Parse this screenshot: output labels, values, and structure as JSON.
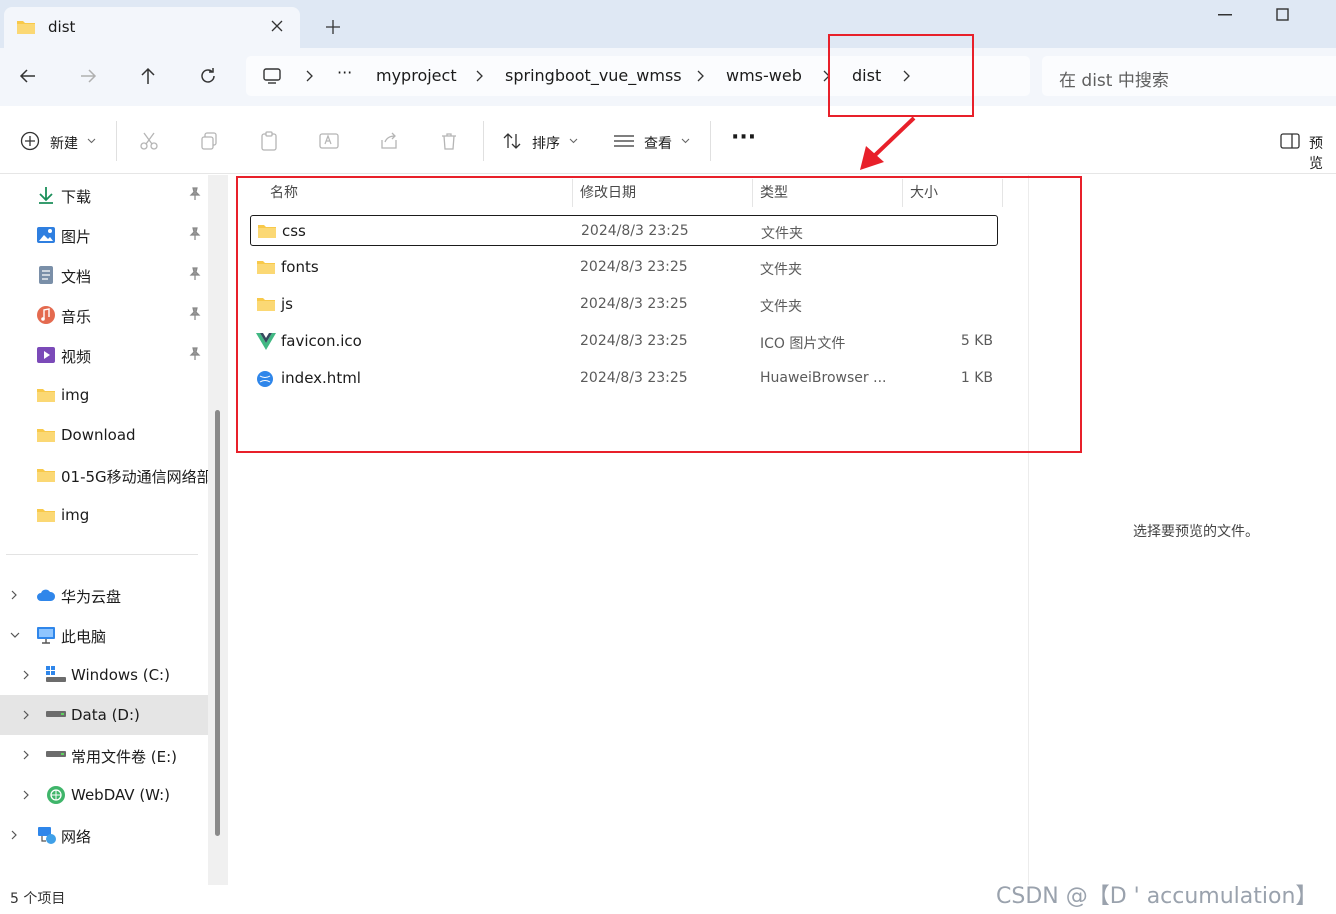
{
  "window": {
    "tab_title": "dist",
    "new_tab_symbol": "+"
  },
  "nav": {
    "breadcrumb": [
      "myproject",
      "springboot_vue_wmss",
      "wms-web",
      "dist"
    ],
    "ellipsis": "···",
    "search_placeholder": "在 dist 中搜索"
  },
  "toolbar": {
    "new_label": "新建",
    "sort_label": "排序",
    "view_label": "查看",
    "more_label": "···",
    "preview_label": "预览"
  },
  "sidebar": {
    "quick_access": [
      {
        "label": "下载",
        "icon": "download-icon",
        "pinned": true
      },
      {
        "label": "图片",
        "icon": "pictures-icon",
        "pinned": true
      },
      {
        "label": "文档",
        "icon": "documents-icon",
        "pinned": true
      },
      {
        "label": "音乐",
        "icon": "music-icon",
        "pinned": true
      },
      {
        "label": "视频",
        "icon": "videos-icon",
        "pinned": true
      },
      {
        "label": "img",
        "icon": "folder-icon",
        "pinned": false
      },
      {
        "label": "Download",
        "icon": "folder-icon",
        "pinned": false
      },
      {
        "label": "01-5G移动通信网络部",
        "icon": "folder-icon",
        "pinned": false
      },
      {
        "label": "img",
        "icon": "folder-icon",
        "pinned": false
      }
    ],
    "tree": [
      {
        "label": "华为云盘",
        "icon": "cloud-icon",
        "expanded": false
      },
      {
        "label": "此电脑",
        "icon": "this-pc-icon",
        "expanded": true
      },
      {
        "label": "Windows (C:)",
        "icon": "drive-c-icon",
        "expanded": false
      },
      {
        "label": "Data (D:)",
        "icon": "drive-icon",
        "expanded": false,
        "selected": true
      },
      {
        "label": "常用文件卷 (E:)",
        "icon": "drive-icon",
        "expanded": false
      },
      {
        "label": "WebDAV (W:)",
        "icon": "webdav-icon",
        "expanded": false
      },
      {
        "label": "网络",
        "icon": "network-icon",
        "expanded": false
      }
    ]
  },
  "file_list": {
    "columns": {
      "name": "名称",
      "date": "修改日期",
      "type": "类型",
      "size": "大小"
    },
    "rows": [
      {
        "name": "css",
        "date": "2024/8/3 23:25",
        "type": "文件夹",
        "size": "",
        "icon": "folder-icon"
      },
      {
        "name": "fonts",
        "date": "2024/8/3 23:25",
        "type": "文件夹",
        "size": "",
        "icon": "folder-icon"
      },
      {
        "name": "js",
        "date": "2024/8/3 23:25",
        "type": "文件夹",
        "size": "",
        "icon": "folder-icon"
      },
      {
        "name": "favicon.ico",
        "date": "2024/8/3 23:25",
        "type": "ICO 图片文件",
        "size": "5 KB",
        "icon": "vue-logo-icon"
      },
      {
        "name": "index.html",
        "date": "2024/8/3 23:25",
        "type": "HuaweiBrowser ...",
        "size": "1 KB",
        "icon": "browser-html-icon"
      }
    ]
  },
  "preview": {
    "message": "选择要预览的文件。"
  },
  "status": {
    "item_count": "5 个项目"
  },
  "watermark": "CSDN @【D ' accumulation】",
  "colors": {
    "annotation_red": "#e8202a",
    "folder_yellow": "#f8c94a",
    "accent_blue": "#1e6fd9"
  }
}
